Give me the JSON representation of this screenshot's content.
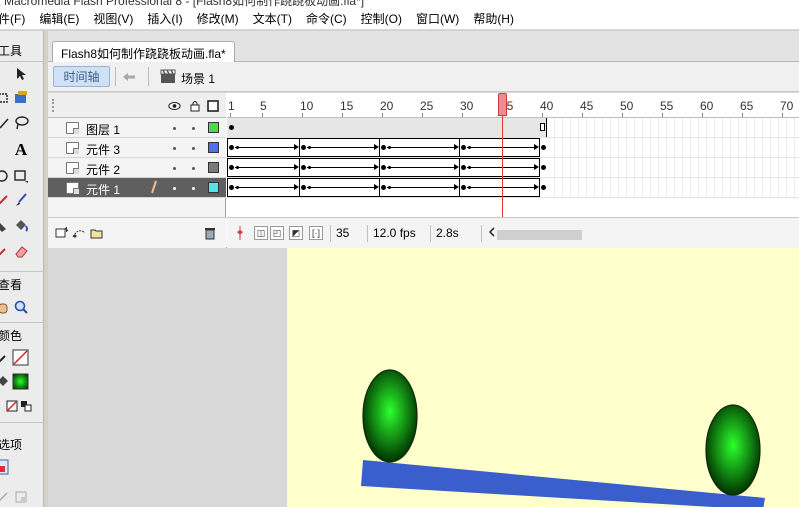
{
  "window": {
    "title": "Macromedia Flash Professional 8 - [Flash8如何制作跷跷板动画.fla*]"
  },
  "menu": [
    "件(F)",
    "编辑(E)",
    "视图(V)",
    "插入(I)",
    "修改(M)",
    "文本(T)",
    "命令(C)",
    "控制(O)",
    "窗口(W)",
    "帮助(H)"
  ],
  "toolbox": {
    "sections": {
      "tools": "工具",
      "view": "查看",
      "colors": "颜色",
      "options": "选项"
    }
  },
  "document": {
    "tab_label": "Flash8如何制作跷跷板动画.fla*",
    "timeline_button": "时间轴",
    "scene_label": "场景 1"
  },
  "timeline": {
    "ruler_numbers": [
      "1",
      "5",
      "10",
      "15",
      "20",
      "25",
      "30",
      "35",
      "40",
      "45",
      "50",
      "55",
      "60",
      "65",
      "70"
    ],
    "layers": [
      {
        "name": "图层 1",
        "color": "#4fd84f",
        "selected": false
      },
      {
        "name": "元件 3",
        "color": "#4f6ff0",
        "selected": false
      },
      {
        "name": "元件 2",
        "color": "#7a7a7a",
        "selected": false
      },
      {
        "name": "元件 1",
        "color": "#4fe8e8",
        "selected": true
      }
    ],
    "keyframes": [
      1,
      10,
      20,
      30,
      40
    ],
    "total_frames": 40,
    "current_frame": "35",
    "frame_rate": "12.0 fps",
    "elapsed_time": "2.8s"
  },
  "colors": {
    "stage_background": "#ffffcc",
    "seesaw_board": "#3a5fcd",
    "ball_highlight": "#2cff2c",
    "ball_shadow": "#003300",
    "playhead": "#d93a3a"
  }
}
